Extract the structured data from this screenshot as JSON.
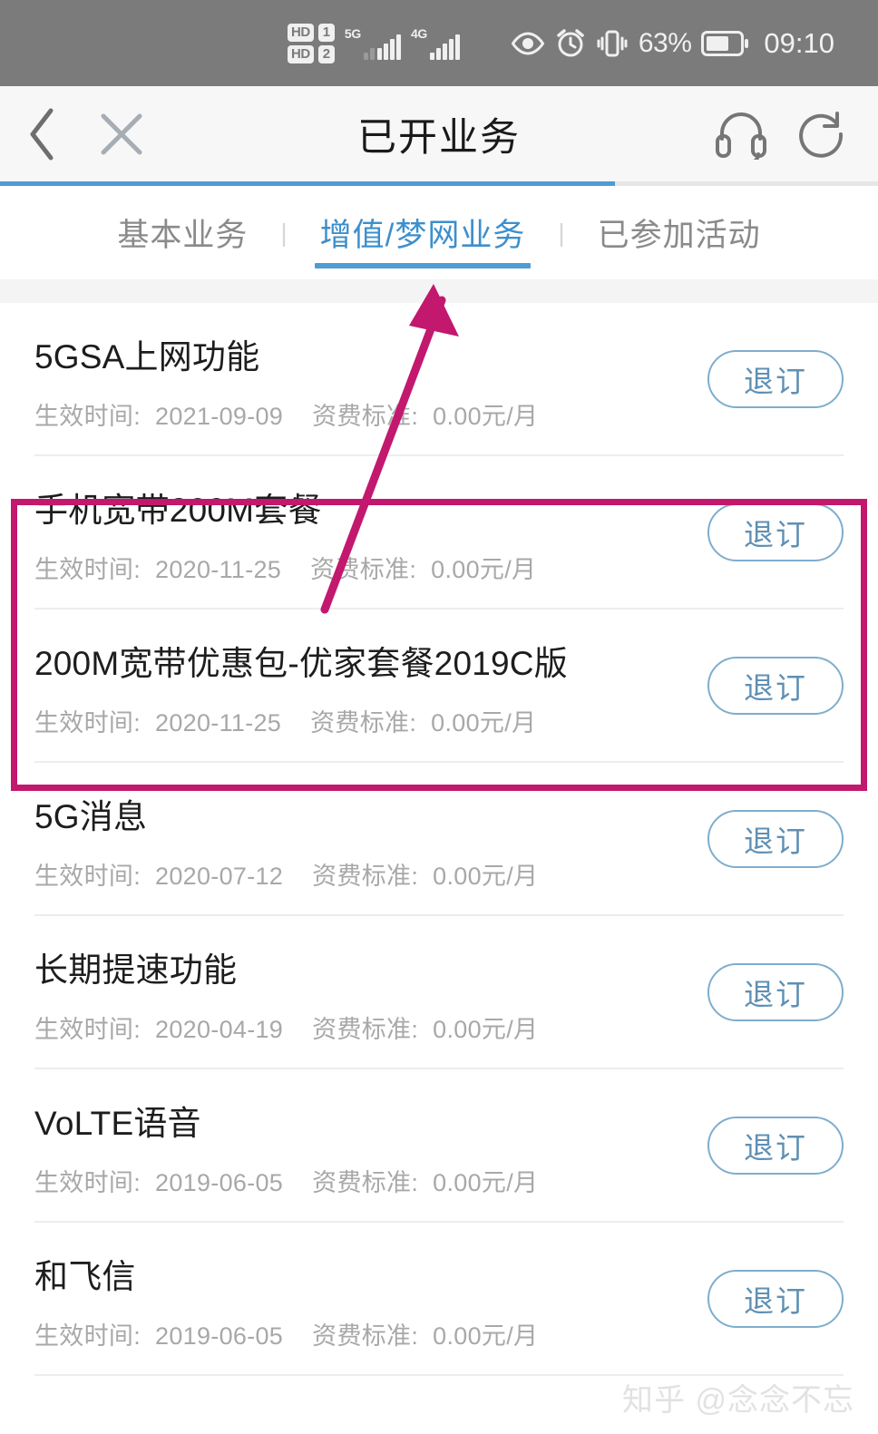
{
  "status_bar": {
    "hd_label_1": "HD",
    "sim_1": "1",
    "hd_label_2": "HD",
    "sim_2": "2",
    "network_1": "5G",
    "network_2": "4G",
    "battery_percent": "63%",
    "time": "09:10",
    "icons": [
      "eye-icon",
      "alarm-clock-icon",
      "vibrate-icon",
      "battery-icon"
    ]
  },
  "header": {
    "title": "已开业务",
    "back_icon": "chevron-left-icon",
    "close_icon": "close-icon",
    "support_icon": "headset-icon",
    "refresh_icon": "refresh-icon",
    "progress_percent": 70
  },
  "tabs": {
    "separator": "|",
    "items": [
      {
        "label": "基本业务",
        "active": false
      },
      {
        "label": "增值/梦网业务",
        "active": true
      },
      {
        "label": "已参加活动",
        "active": false
      }
    ]
  },
  "list": {
    "effective_label": "生效时间:",
    "fee_label": "资费标准:",
    "unsubscribe_label": "退订",
    "items": [
      {
        "name": "5GSA上网功能",
        "effective_date": "2021-09-09",
        "fee": "0.00元/月"
      },
      {
        "name": "手机宽带200M套餐",
        "effective_date": "2020-11-25",
        "fee": "0.00元/月"
      },
      {
        "name": "200M宽带优惠包-优家套餐2019C版",
        "effective_date": "2020-11-25",
        "fee": "0.00元/月"
      },
      {
        "name": "5G消息",
        "effective_date": "2020-07-12",
        "fee": "0.00元/月"
      },
      {
        "name": "长期提速功能",
        "effective_date": "2020-04-19",
        "fee": "0.00元/月"
      },
      {
        "name": "VoLTE语音",
        "effective_date": "2019-06-05",
        "fee": "0.00元/月"
      },
      {
        "name": "和飞信",
        "effective_date": "2019-06-05",
        "fee": "0.00元/月"
      }
    ]
  },
  "annotations": {
    "highlight_color": "#c2186e",
    "arrow_color": "#c2186e",
    "highlight_rows": [
      1,
      2
    ],
    "arrow_points_to": "增值/梦网业务"
  },
  "watermark": {
    "text": "知乎 @念念不忘"
  }
}
